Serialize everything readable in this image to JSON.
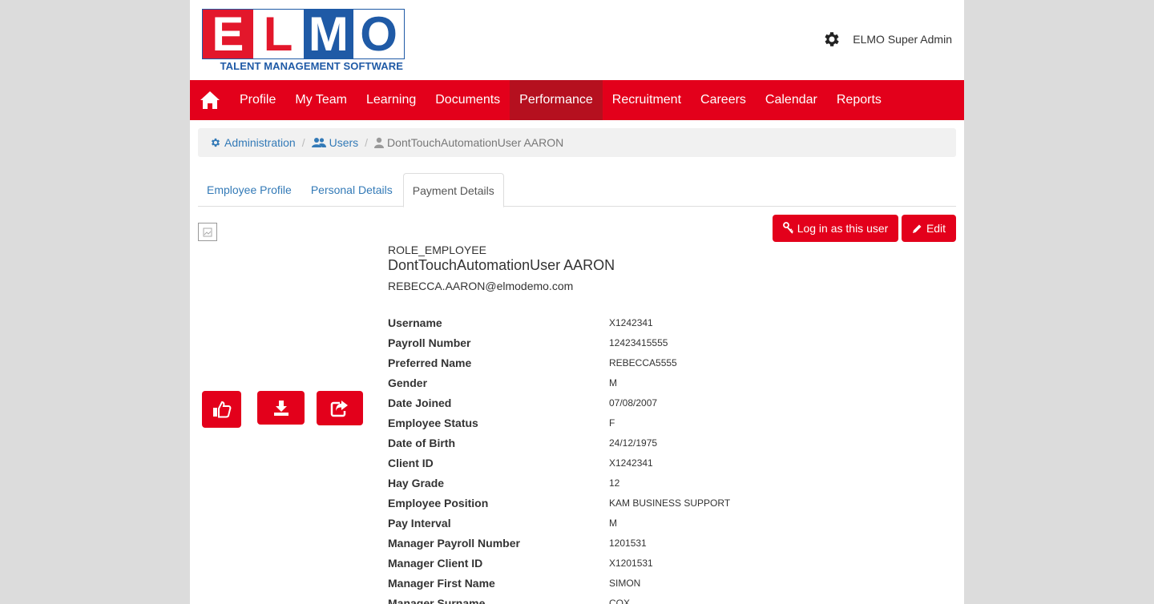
{
  "header": {
    "logo_letters": [
      "E",
      "L",
      "M",
      "O"
    ],
    "logo_tagline": "TALENT MANAGEMENT SOFTWARE",
    "admin_name": "ELMO Super Admin",
    "gear_icon": "gear-icon"
  },
  "nav": {
    "home_icon": "home-icon",
    "items": [
      {
        "label": "Profile"
      },
      {
        "label": "My Team"
      },
      {
        "label": "Learning"
      },
      {
        "label": "Documents"
      },
      {
        "label": "Performance",
        "active": true
      },
      {
        "label": "Recruitment"
      },
      {
        "label": "Careers"
      },
      {
        "label": "Calendar"
      },
      {
        "label": "Reports"
      }
    ],
    "color": "#e3001b",
    "active_color": "#b5101f"
  },
  "breadcrumb": {
    "administration": "Administration",
    "users": "Users",
    "separator": "/",
    "current": "DontTouchAutomationUser AARON"
  },
  "tabs": [
    {
      "label": "Employee Profile"
    },
    {
      "label": "Personal Details"
    },
    {
      "label": "Payment Details",
      "active": true
    }
  ],
  "actions": {
    "login_label": "Log in as this user",
    "edit_label": "Edit"
  },
  "profile": {
    "role": "ROLE_EMPLOYEE",
    "name": "DontTouchAutomationUser AARON",
    "email": "REBECCA.AARON@elmodemo.com"
  },
  "details": [
    {
      "label": "Username",
      "value": "X1242341"
    },
    {
      "label": "Payroll Number",
      "value": "12423415555"
    },
    {
      "label": "Preferred Name",
      "value": "REBECCA5555"
    },
    {
      "label": "Gender",
      "value": "M"
    },
    {
      "label": "Date Joined",
      "value": "07/08/2007"
    },
    {
      "label": "Employee Status",
      "value": "F"
    },
    {
      "label": "Date of Birth",
      "value": "24/12/1975"
    },
    {
      "label": "Client ID",
      "value": "X1242341"
    },
    {
      "label": "Hay Grade",
      "value": "12"
    },
    {
      "label": "Employee Position",
      "value": "KAM BUSINESS SUPPORT"
    },
    {
      "label": "Pay Interval",
      "value": "M"
    },
    {
      "label": "Manager Payroll Number",
      "value": "1201531"
    },
    {
      "label": "Manager Client ID",
      "value": "X1201531"
    },
    {
      "label": "Manager First Name",
      "value": "SIMON"
    },
    {
      "label": "Manager Surname",
      "value": "COX"
    }
  ]
}
